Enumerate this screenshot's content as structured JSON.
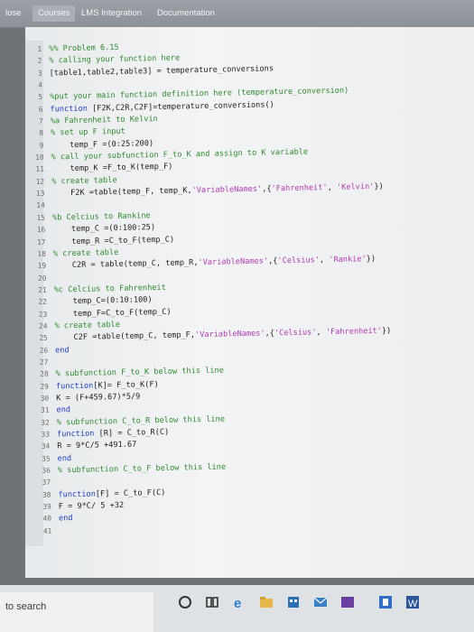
{
  "nav": {
    "tabs": [
      "lose",
      "Courses",
      "LMS Integration",
      "Documentation"
    ]
  },
  "code_lines": [
    {
      "n": "1",
      "parts": [
        [
          "c",
          "%% Problem 6.15"
        ]
      ]
    },
    {
      "n": "2",
      "parts": [
        [
          "c",
          "% calling your function here"
        ]
      ]
    },
    {
      "n": "3",
      "parts": [
        [
          "p",
          "[table1,table2,table3] = temperature_conversions"
        ]
      ]
    },
    {
      "n": "4",
      "parts": []
    },
    {
      "n": "5",
      "parts": [
        [
          "c",
          "%put your main function definition here (temperature_conversion)"
        ]
      ]
    },
    {
      "n": "6",
      "parts": [
        [
          "k",
          "function "
        ],
        [
          "p",
          "[F2K,C2R,C2F]=temperature_conversions()"
        ]
      ]
    },
    {
      "n": "7",
      "parts": [
        [
          "c",
          "%a Fahrenheit to Kelvin"
        ]
      ]
    },
    {
      "n": "8",
      "parts": [
        [
          "c",
          "% set up F input"
        ]
      ]
    },
    {
      "n": "9",
      "parts": [
        [
          "p",
          "    temp_F =(0:25:200)"
        ]
      ]
    },
    {
      "n": "10",
      "parts": [
        [
          "c",
          "% call your subfunction F_to_K and assign to K variable"
        ]
      ]
    },
    {
      "n": "11",
      "parts": [
        [
          "p",
          "    temp_K =F_to_K(temp_F)"
        ]
      ]
    },
    {
      "n": "12",
      "parts": [
        [
          "c",
          "% create table"
        ]
      ]
    },
    {
      "n": "13",
      "parts": [
        [
          "p",
          "    F2K =table(temp_F, temp_K,"
        ],
        [
          "s",
          "'VariableNames'"
        ],
        [
          "p",
          ",{"
        ],
        [
          "s",
          "'Fahrenheit'"
        ],
        [
          "p",
          ", "
        ],
        [
          "s",
          "'Kelvin'"
        ],
        [
          "p",
          "})"
        ]
      ]
    },
    {
      "n": "14",
      "parts": []
    },
    {
      "n": "15",
      "parts": [
        [
          "c",
          "%b Celcius to Rankine"
        ]
      ]
    },
    {
      "n": "16",
      "parts": [
        [
          "p",
          "    temp_C =(0:100:25)"
        ]
      ]
    },
    {
      "n": "17",
      "parts": [
        [
          "p",
          "    temp_R =C_to_F(temp_C)"
        ]
      ]
    },
    {
      "n": "18",
      "parts": [
        [
          "c",
          "% create table"
        ]
      ]
    },
    {
      "n": "19",
      "parts": [
        [
          "p",
          "    C2R = table(temp_C, temp_R,"
        ],
        [
          "s",
          "'VariableNames'"
        ],
        [
          "p",
          ",{"
        ],
        [
          "s",
          "'Celsius'"
        ],
        [
          "p",
          ", "
        ],
        [
          "s",
          "'Rankie'"
        ],
        [
          "p",
          "})"
        ]
      ]
    },
    {
      "n": "20",
      "parts": []
    },
    {
      "n": "21",
      "parts": [
        [
          "c",
          "%c Celcius to Fahrenheit"
        ]
      ]
    },
    {
      "n": "22",
      "parts": [
        [
          "p",
          "    temp_C=(0:10:100)"
        ]
      ]
    },
    {
      "n": "23",
      "parts": [
        [
          "p",
          "    temp_F=C_to_F(temp_C)"
        ]
      ]
    },
    {
      "n": "24",
      "parts": [
        [
          "c",
          "% create table"
        ]
      ]
    },
    {
      "n": "25",
      "parts": [
        [
          "p",
          "    C2F =table(temp_C, temp_F,"
        ],
        [
          "s",
          "'VariableNames'"
        ],
        [
          "p",
          ",{"
        ],
        [
          "s",
          "'Celsius'"
        ],
        [
          "p",
          ", "
        ],
        [
          "s",
          "'Fahrenheit'"
        ],
        [
          "p",
          "})"
        ]
      ]
    },
    {
      "n": "26",
      "parts": [
        [
          "k",
          "end"
        ]
      ]
    },
    {
      "n": "27",
      "parts": []
    },
    {
      "n": "28",
      "parts": [
        [
          "c",
          "% subfunction F_to_K below this line"
        ]
      ]
    },
    {
      "n": "29",
      "parts": [
        [
          "k",
          "function"
        ],
        [
          "p",
          "[K]= F_to_K(F)"
        ]
      ]
    },
    {
      "n": "30",
      "parts": [
        [
          "p",
          "K = (F+459.67)*5/9"
        ]
      ]
    },
    {
      "n": "31",
      "parts": [
        [
          "k",
          "end"
        ]
      ]
    },
    {
      "n": "32",
      "parts": [
        [
          "c",
          "% subfunction C_to_R below this line"
        ]
      ]
    },
    {
      "n": "33",
      "parts": [
        [
          "k",
          "function "
        ],
        [
          "p",
          "[R] = C_to_R(C)"
        ]
      ]
    },
    {
      "n": "34",
      "parts": [
        [
          "p",
          "R = 9*C/5 +491.67"
        ]
      ]
    },
    {
      "n": "35",
      "parts": [
        [
          "k",
          "end"
        ]
      ]
    },
    {
      "n": "36",
      "parts": [
        [
          "c",
          "% subfunction C_to_F below this line"
        ]
      ]
    },
    {
      "n": "37",
      "parts": []
    },
    {
      "n": "38",
      "parts": [
        [
          "k",
          "function"
        ],
        [
          "p",
          "[F] = C_to_F(C)"
        ]
      ]
    },
    {
      "n": "39",
      "parts": [
        [
          "p",
          "F = 9*C/ 5 +32"
        ]
      ]
    },
    {
      "n": "40",
      "parts": [
        [
          "k",
          "end"
        ]
      ]
    },
    {
      "n": "41",
      "parts": []
    }
  ],
  "taskbar": {
    "search_text": "to search",
    "icons": [
      "cortana-icon",
      "task-view-icon",
      "edge-icon",
      "file-explorer-icon",
      "store-icon",
      "mail-icon",
      "app-icon",
      "office-icon"
    ]
  }
}
